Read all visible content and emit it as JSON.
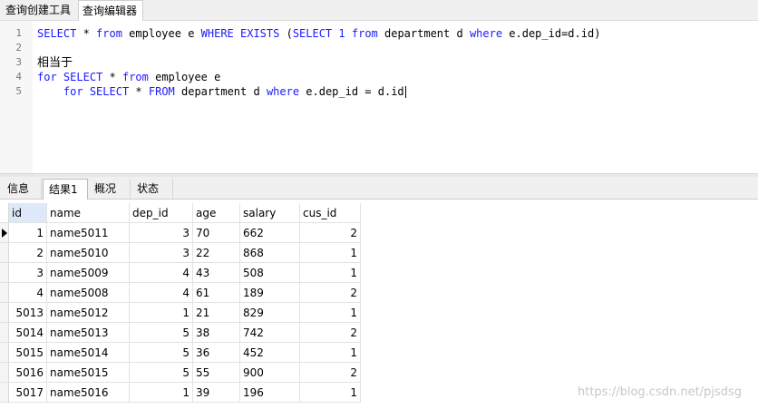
{
  "tabs": [
    "查询创建工具",
    "查询编辑器"
  ],
  "editor": {
    "lines": [
      {
        "n": "1",
        "tokens": [
          [
            "kw",
            "SELECT"
          ],
          [
            "t",
            " * "
          ],
          [
            "kw",
            "from"
          ],
          [
            "t",
            " employee e "
          ],
          [
            "kw",
            "WHERE EXISTS"
          ],
          [
            "t",
            " ("
          ],
          [
            "kw",
            "SELECT"
          ],
          [
            "t",
            " "
          ],
          [
            "num",
            "1"
          ],
          [
            "t",
            " "
          ],
          [
            "kw",
            "from"
          ],
          [
            "t",
            " department d "
          ],
          [
            "kw",
            "where"
          ],
          [
            "t",
            " e.dep_id=d.id)"
          ]
        ]
      },
      {
        "n": "2",
        "tokens": []
      },
      {
        "n": "3",
        "tokens": [
          [
            "cjk",
            "相当于"
          ]
        ]
      },
      {
        "n": "4",
        "tokens": [
          [
            "kw",
            "for"
          ],
          [
            "t",
            " "
          ],
          [
            "kw",
            "SELECT"
          ],
          [
            "t",
            " * "
          ],
          [
            "kw",
            "from"
          ],
          [
            "t",
            " employee e"
          ]
        ]
      },
      {
        "n": "5",
        "tokens": [
          [
            "t",
            "    "
          ],
          [
            "kw",
            "for"
          ],
          [
            "t",
            " "
          ],
          [
            "kw",
            "SELECT"
          ],
          [
            "t",
            " * "
          ],
          [
            "kw",
            "FROM"
          ],
          [
            "t",
            " department d "
          ],
          [
            "kw",
            "where"
          ],
          [
            "t",
            " e.dep_id = d.id"
          ]
        ]
      }
    ]
  },
  "result_tabs": [
    "信息",
    "结果1",
    "概况",
    "状态"
  ],
  "grid": {
    "columns": [
      "id",
      "name",
      "dep_id",
      "age",
      "salary",
      "cus_id"
    ],
    "rows": [
      [
        "1",
        "name5011",
        "3",
        "70",
        "662",
        "2"
      ],
      [
        "2",
        "name5010",
        "3",
        "22",
        "868",
        "1"
      ],
      [
        "3",
        "name5009",
        "4",
        "43",
        "508",
        "1"
      ],
      [
        "4",
        "name5008",
        "4",
        "61",
        "189",
        "2"
      ],
      [
        "5013",
        "name5012",
        "1",
        "21",
        "829",
        "1"
      ],
      [
        "5014",
        "name5013",
        "5",
        "38",
        "742",
        "2"
      ],
      [
        "5015",
        "name5014",
        "5",
        "36",
        "452",
        "1"
      ],
      [
        "5016",
        "name5015",
        "5",
        "55",
        "900",
        "2"
      ],
      [
        "5017",
        "name5016",
        "1",
        "39",
        "196",
        "1"
      ]
    ]
  },
  "watermark": "https://blog.csdn.net/pjsdsg"
}
